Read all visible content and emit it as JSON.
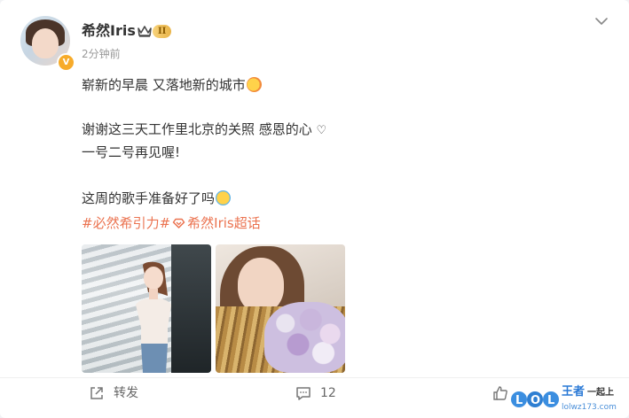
{
  "post": {
    "author": {
      "name": "希然Iris",
      "level_badge": "II"
    },
    "time": "2分钟前",
    "lines": {
      "line1": "崭新的早晨  又落地新的城市",
      "line2": "谢谢这三天工作里北京的关照 感恩的心 ",
      "line2_heart": "♡",
      "line3": "一号二号再见喔!",
      "line4": "这周的歌手准备好了吗"
    },
    "hashtags": {
      "tag1": "#必然希引力#",
      "tag2": "希然Iris超话"
    },
    "images": [
      {
        "description_icon": "image"
      },
      {
        "description_icon": "image"
      }
    ]
  },
  "actions": {
    "forward_label": "转发",
    "comment_count": "12"
  },
  "watermark": {
    "brand_text": "王者",
    "brand_sub": "一起上",
    "url": "lolwz173.com"
  },
  "colors": {
    "accent": "#eb7350",
    "text": "#333333",
    "muted": "#999999",
    "badge": "#f7ab2a"
  }
}
